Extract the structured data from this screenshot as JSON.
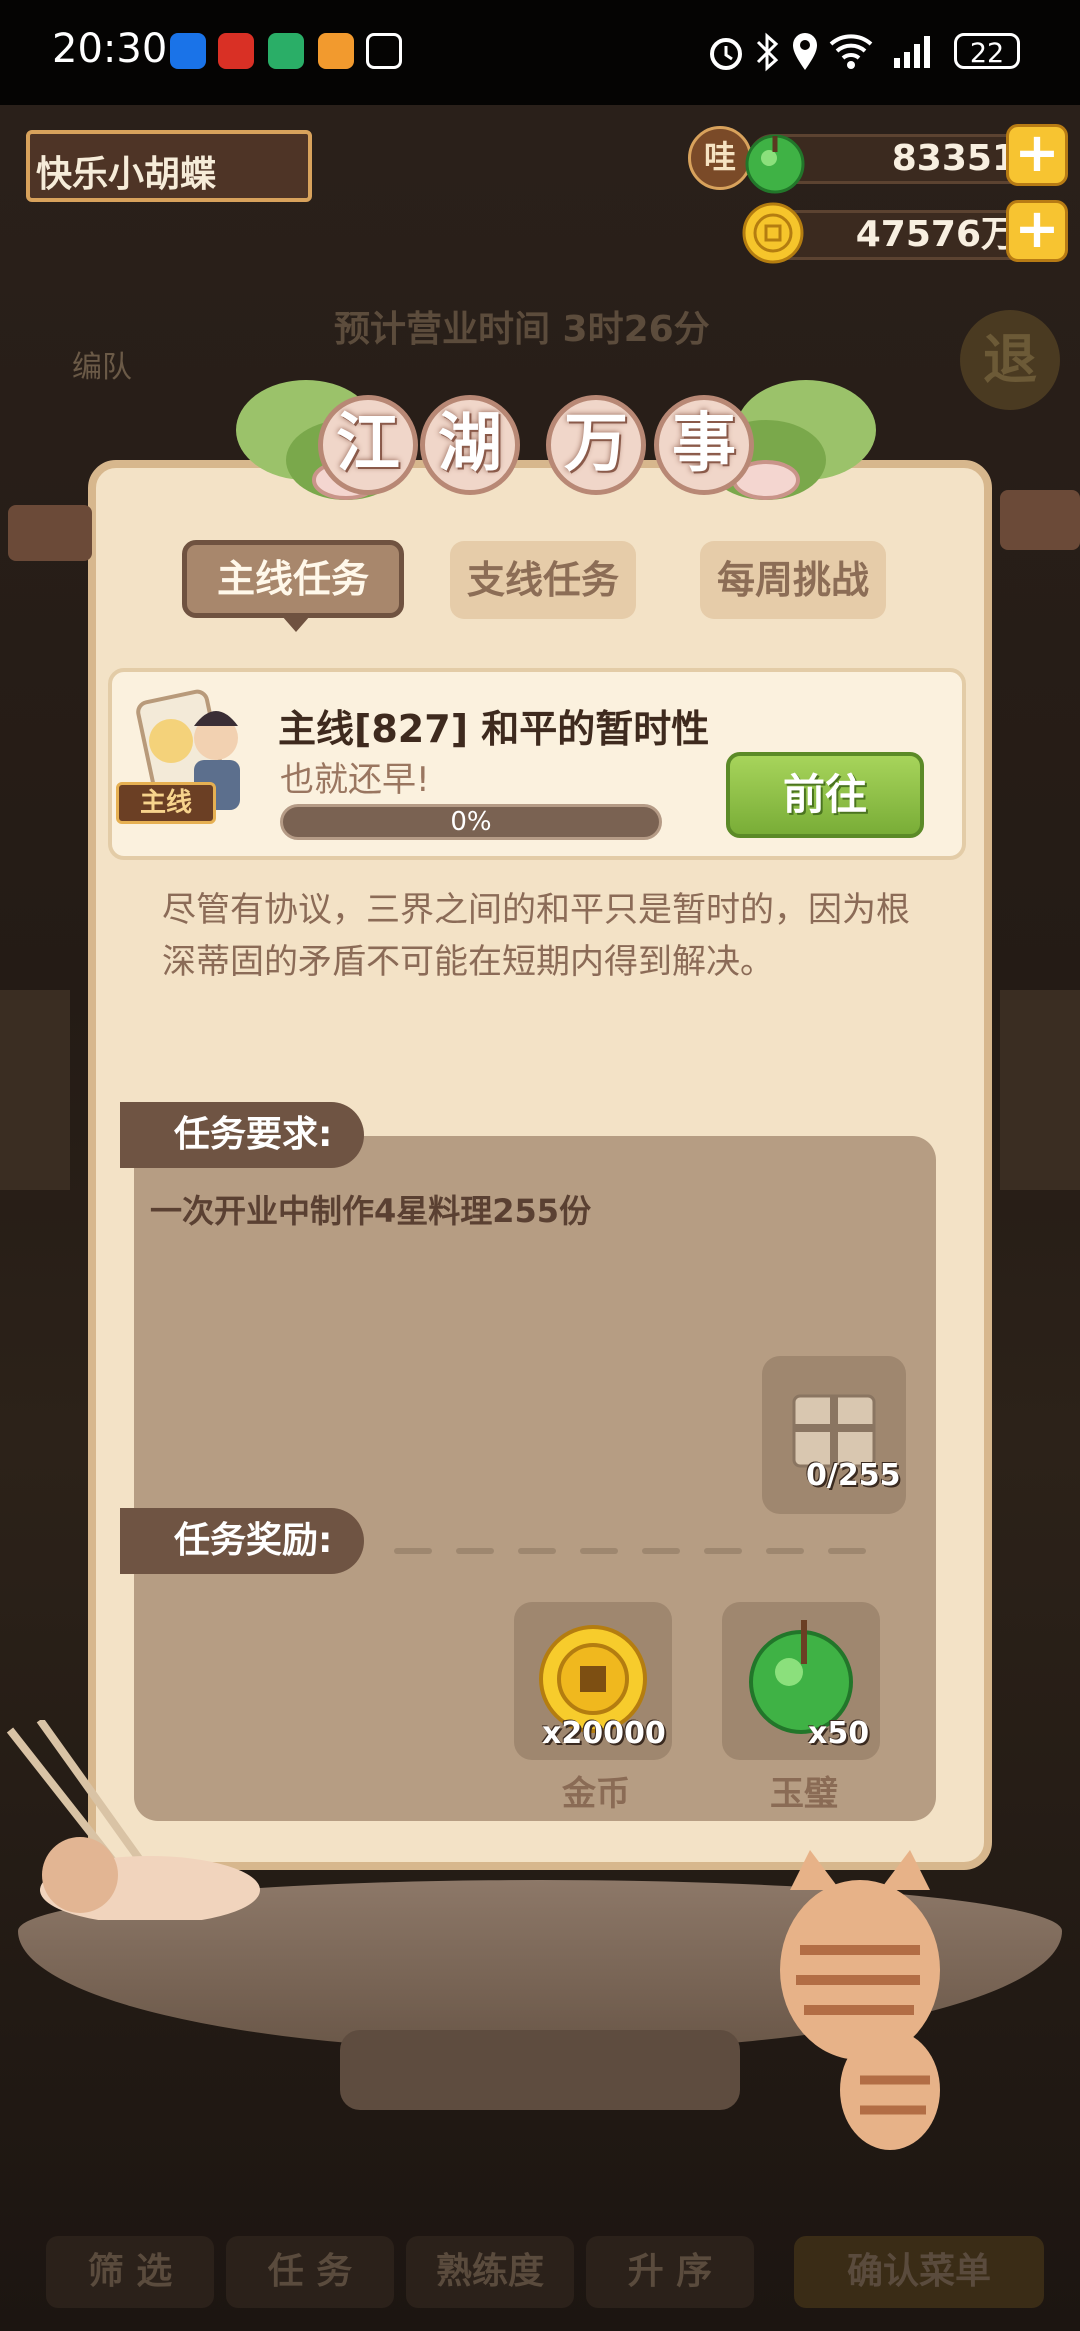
{
  "status_bar": {
    "time": "20:30",
    "battery": "22",
    "app_icons": [
      "app-icon-blue",
      "app-icon-red",
      "wechat-icon",
      "game-icon",
      "nfc-icon"
    ],
    "indicator_icons": [
      "alarm-icon",
      "bluetooth-icon",
      "location-icon",
      "wifi-icon",
      "signal-icon"
    ]
  },
  "player": {
    "name": "快乐小胡蝶"
  },
  "currency": {
    "jade_amount": "83351",
    "jade_badge": "哇",
    "coin_amount": "47576万"
  },
  "background": {
    "business_time": "预计营业时间  3时26分",
    "team_label": "编队",
    "exit_label": "退",
    "bottom_buttons": [
      "筛 选",
      "任 务",
      "熟练度",
      "升 序",
      "确认菜单"
    ]
  },
  "panel": {
    "title_chars": [
      "江",
      "湖",
      "万",
      "事"
    ],
    "tabs": [
      {
        "label": "主线任务",
        "active": true
      },
      {
        "label": "支线任务",
        "active": false
      },
      {
        "label": "每周挑战",
        "active": false
      }
    ],
    "quest": {
      "tag": "主线",
      "title": "主线[827] 和平的暂时性",
      "subtitle": "也就还早!",
      "progress_text": "0%",
      "progress": 0,
      "go_button": "前往",
      "description": "尽管有协议，三界之间的和平只是暂时的，因为根深蒂固的矛盾不可能在短期内得到解决。"
    },
    "requirement": {
      "label": "任务要求:",
      "text": "一次开业中制作4星料理255份",
      "item_count": "0/255"
    },
    "rewards": {
      "label": "任务奖励:",
      "items": [
        {
          "name": "金币",
          "count": "x20000",
          "icon": "gold-coin-icon"
        },
        {
          "name": "玉璧",
          "count": "x50",
          "icon": "jade-disc-icon"
        }
      ]
    }
  },
  "colors": {
    "panel_bg": "#f3e2c6",
    "accent_green": "#79ad37",
    "tab_active": "#a8876c",
    "coin_gold": "#f7c431"
  }
}
